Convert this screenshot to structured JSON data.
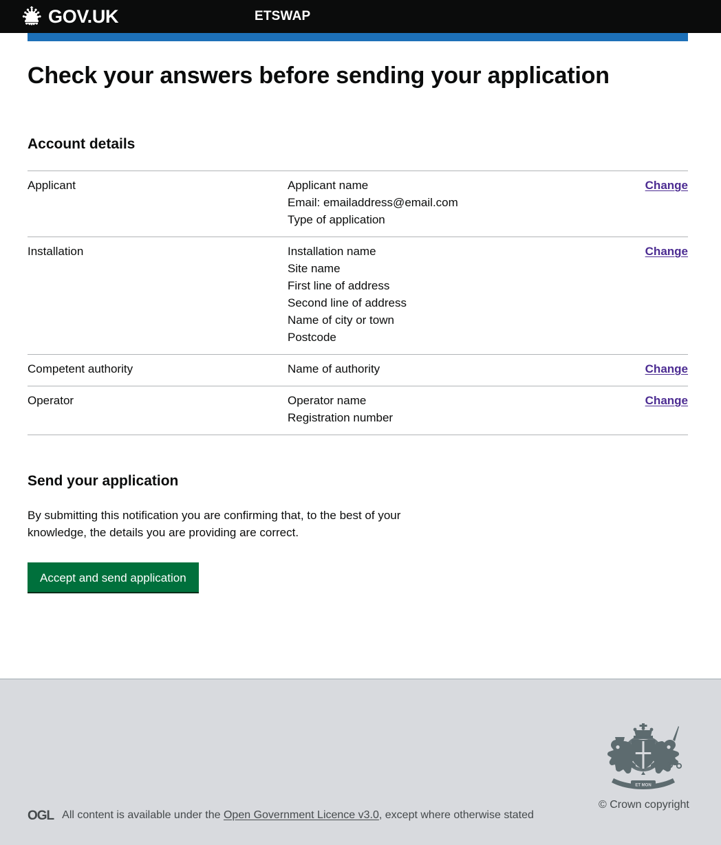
{
  "header": {
    "logo_text": "GOV.UK",
    "crown_icon": "crown-icon",
    "service_name": "ETSWAP"
  },
  "main": {
    "page_title": "Check your answers before sending your application",
    "account_details": {
      "heading": "Account details",
      "rows": [
        {
          "key": "Applicant",
          "values": [
            "Applicant name",
            "Email: emailaddress@email.com",
            "Type of application"
          ],
          "action": "Change"
        },
        {
          "key": "Installation",
          "values": [
            "Installation name",
            "Site name",
            "First line of address",
            "Second line of address",
            "Name of city or town",
            "Postcode"
          ],
          "action": "Change"
        },
        {
          "key": "Competent authority",
          "values": [
            "Name of authority"
          ],
          "action": "Change"
        },
        {
          "key": "Operator",
          "values": [
            "Operator name",
            "Registration number"
          ],
          "action": "Change"
        }
      ]
    },
    "send_application": {
      "heading": "Send your application",
      "body": "By submitting this notification you are confirming that, to the best of your knowledge, the details you are providing are correct.",
      "button_label": "Accept and send application"
    }
  },
  "footer": {
    "ogl_logo_text": "OGL",
    "licence_prefix": "All content is available under the ",
    "licence_link": "Open Government Licence v3.0",
    "licence_suffix": ", except where otherwise stated",
    "crown_copyright": "© Crown copyright",
    "crest_icon": "royal-coat-of-arms-icon"
  },
  "colors": {
    "header_bg": "#0b0c0c",
    "blue_bar": "#1d70b8",
    "link": "#4c2c92",
    "button_green": "#00703c",
    "footer_bg": "#d8dade",
    "border_grey": "#b1b4b6"
  }
}
